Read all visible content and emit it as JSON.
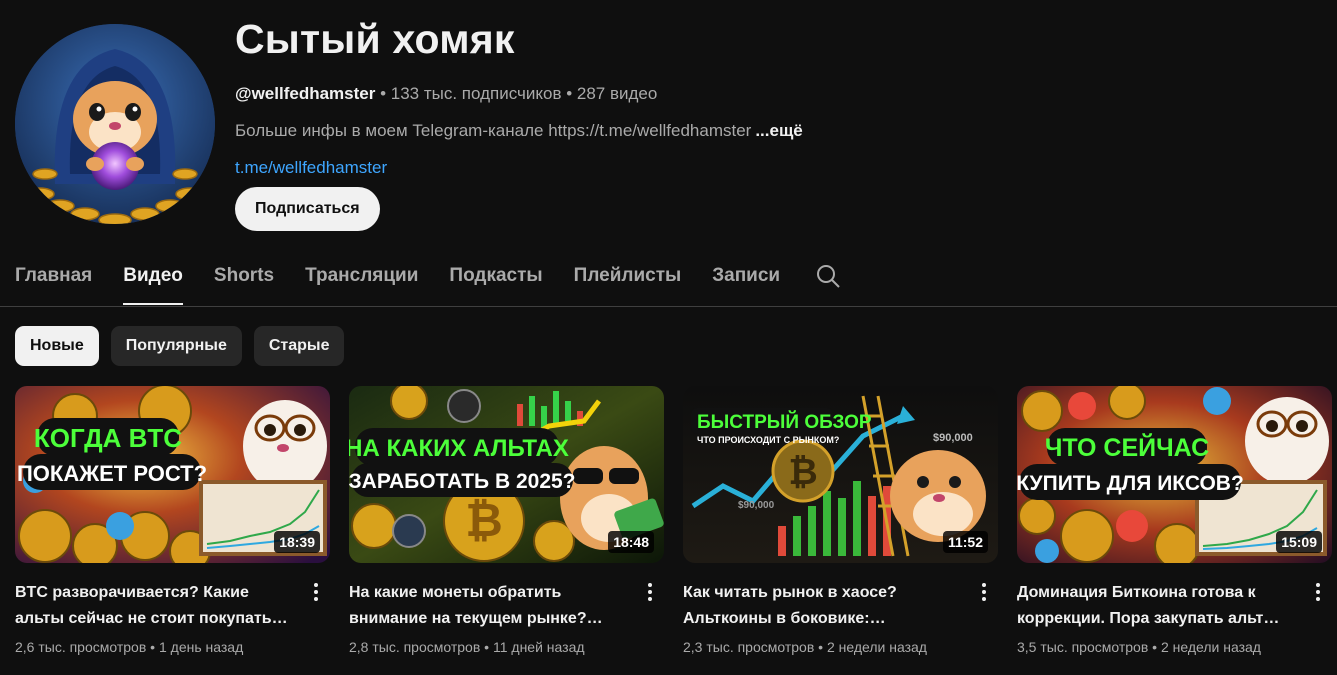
{
  "channel": {
    "title": "Сытый хомяк",
    "handle": "@wellfedhamster",
    "subscribers": "133 тыс. подписчиков",
    "video_count": "287 видео",
    "separator": " • ",
    "description": "Больше инфы в моем Telegram-канале https://t.me/wellfedhamster",
    "more": "...ещё",
    "link": "t.me/wellfedhamster",
    "subscribe_label": "Подписаться"
  },
  "tabs": [
    {
      "label": "Главная",
      "active": false
    },
    {
      "label": "Видео",
      "active": true
    },
    {
      "label": "Shorts",
      "active": false
    },
    {
      "label": "Трансляции",
      "active": false
    },
    {
      "label": "Подкасты",
      "active": false
    },
    {
      "label": "Плейлисты",
      "active": false
    },
    {
      "label": "Записи",
      "active": false
    }
  ],
  "search_icon": "search-icon",
  "chips": [
    {
      "label": "Новые",
      "active": true
    },
    {
      "label": "Популярные",
      "active": false
    },
    {
      "label": "Старые",
      "active": false
    }
  ],
  "videos": [
    {
      "title": "BTC разворачивается? Какие альты сейчас не стоит покупать…",
      "views": "2,6 тыс. просмотров",
      "age": "1 день назад",
      "duration": "18:39",
      "thumb_text": [
        "КОГДА BTC",
        "ПОКАЖЕТ РОСТ?"
      ]
    },
    {
      "title": "На какие монеты обратить внимание на текущем рынке?…",
      "views": "2,8 тыс. просмотров",
      "age": "11 дней назад",
      "duration": "18:48",
      "thumb_text": [
        "НА КАКИХ АЛЬТАХ",
        "ЗАРАБОТАТЬ В 2025?"
      ]
    },
    {
      "title": "Как читать рынок в хаосе? Альткоины в боковике:…",
      "views": "2,3 тыс. просмотров",
      "age": "2 недели назад",
      "duration": "11:52",
      "thumb_text": [
        "БЫСТРЫЙ ОБЗОР",
        "ЧТО ПРОИСХОДИТ С РЫНКОМ?",
        "$90,000",
        "$90,000"
      ]
    },
    {
      "title": "Доминация Биткоина готова к коррекции. Пора закупать альт…",
      "views": "3,5 тыс. просмотров",
      "age": "2 недели назад",
      "duration": "15:09",
      "thumb_text": [
        "ЧТО СЕЙЧАС",
        "КУПИТЬ ДЛЯ ИКСОВ?"
      ]
    }
  ],
  "colors": {
    "background": "#0f0f0f",
    "text_primary": "#f1f1f1",
    "text_secondary": "#aaaaaa",
    "link": "#3ea6ff",
    "thumb_green": "#4cff3a"
  }
}
